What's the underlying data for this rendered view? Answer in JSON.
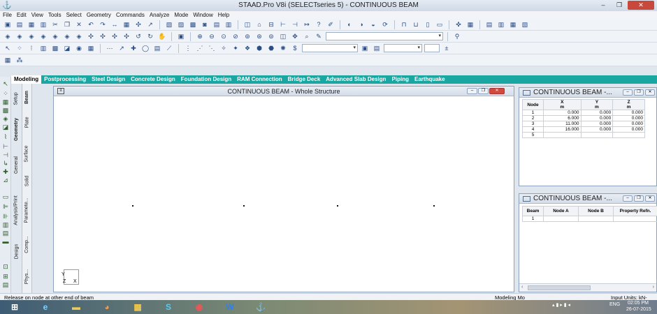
{
  "window": {
    "title": "STAAD.Pro V8i (SELECTseries 5) - CONTINUOUS BEAM",
    "minimize_glyph": "–",
    "maximize_glyph": "❐",
    "close_glyph": "✕"
  },
  "menu": [
    "File",
    "Edit",
    "View",
    "Tools",
    "Select",
    "Geometry",
    "Commands",
    "Analyze",
    "Mode",
    "Window",
    "Help"
  ],
  "page_tabs": [
    {
      "label": "Modeling",
      "active": true
    },
    {
      "label": "Postprocessing",
      "active": false
    },
    {
      "label": "Steel Design",
      "active": false
    },
    {
      "label": "Concrete Design",
      "active": false
    },
    {
      "label": "Foundation Design",
      "active": false
    },
    {
      "label": "RAM Connection",
      "active": false
    },
    {
      "label": "Bridge Deck",
      "active": false
    },
    {
      "label": "Advanced Slab Design",
      "active": false
    },
    {
      "label": "Piping",
      "active": false
    },
    {
      "label": "Earthquake",
      "active": false
    }
  ],
  "side_tabs_outer": [
    "Setup",
    "Geometry",
    "General",
    "Analysis/Print",
    "Design"
  ],
  "side_tabs_inner": [
    "Beam",
    "Plate",
    "Surface",
    "Solid",
    "Paramete...",
    "Comp...",
    "Phys..."
  ],
  "main_window": {
    "title": "CONTINUOUS BEAM - Whole Structure",
    "axis": {
      "y": "Y",
      "z": "Z",
      "x": "X"
    }
  },
  "node_table": {
    "title": "CONTINUOUS BEAM -...",
    "headers": [
      "Node",
      "X",
      "Y",
      "Z"
    ],
    "units": [
      "",
      "m",
      "m",
      "m"
    ],
    "rows": [
      [
        "1",
        "0.000",
        "0.000",
        "0.000"
      ],
      [
        "2",
        "6.000",
        "0.000",
        "0.000"
      ],
      [
        "3",
        "11.000",
        "0.000",
        "0.000"
      ],
      [
        "4",
        "16.000",
        "0.000",
        "0.000"
      ],
      [
        "5",
        "",
        "",
        ""
      ]
    ]
  },
  "beam_table": {
    "title": "CONTINUOUS BEAM -...",
    "headers": [
      "Beam",
      "Node A",
      "Node B",
      "Property Refn."
    ],
    "rows": [
      [
        "1",
        "",
        "",
        ""
      ]
    ]
  },
  "status": {
    "message": "Release on node at other end of beam",
    "mode": "Modeling Mo",
    "units": "Input Units: kN-"
  },
  "taskbar": {
    "tray_lang": "ENG",
    "time": "02:05 PM",
    "date": "26-07-2015"
  }
}
